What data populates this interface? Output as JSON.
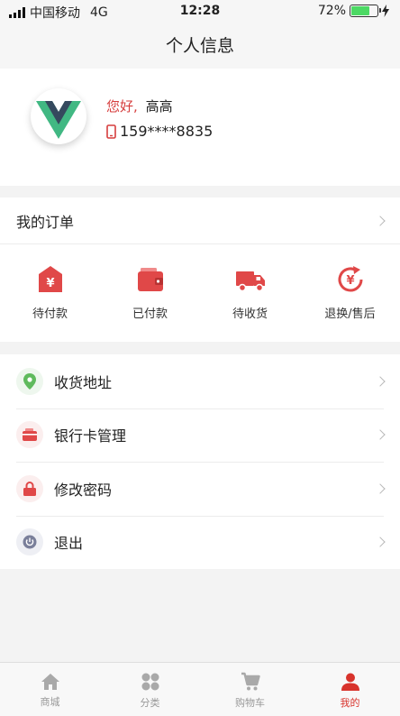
{
  "status_bar": {
    "carrier": "中国移动",
    "network": "4G",
    "time": "12:28",
    "battery": "72%",
    "battery_level": 0.72
  },
  "header": {
    "title": "个人信息"
  },
  "profile": {
    "greeting_prefix": "您好,",
    "name": "高高",
    "phone": "159****8835",
    "avatar_icon": "vue-logo-icon"
  },
  "orders": {
    "title": "我的订单",
    "items": [
      {
        "label": "待付款",
        "icon": "yen-tag-icon"
      },
      {
        "label": "已付款",
        "icon": "wallet-icon"
      },
      {
        "label": "待收货",
        "icon": "truck-icon"
      },
      {
        "label": "退换/售后",
        "icon": "yen-refund-icon"
      }
    ]
  },
  "menu": [
    {
      "label": "收货地址",
      "icon": "location-pin-icon",
      "icon_color": "#5fba5d"
    },
    {
      "label": "银行卡管理",
      "icon": "wallet-card-icon",
      "icon_color": "#e04848"
    },
    {
      "label": "修改密码",
      "icon": "lock-icon",
      "icon_color": "#e04848"
    },
    {
      "label": "退出",
      "icon": "power-icon",
      "icon_color": "#7a7f9a"
    }
  ],
  "tabbar": [
    {
      "label": "商城",
      "icon": "home-icon",
      "active": false
    },
    {
      "label": "分类",
      "icon": "category-icon",
      "active": false
    },
    {
      "label": "购物车",
      "icon": "cart-icon",
      "active": false
    },
    {
      "label": "我的",
      "icon": "user-icon",
      "active": true
    }
  ],
  "colors": {
    "accent": "#d8332c",
    "inactive_tab": "#999999"
  }
}
